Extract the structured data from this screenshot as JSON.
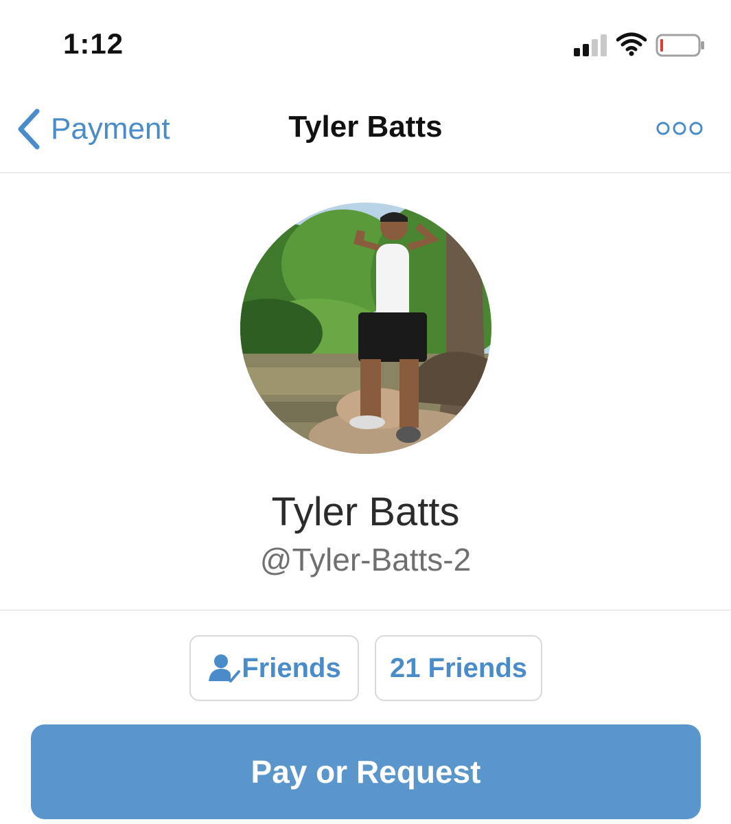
{
  "status_bar": {
    "time": "1:12"
  },
  "nav": {
    "back_label": "Payment",
    "title": "Tyler Batts",
    "accent_color": "#4a8bc9"
  },
  "profile": {
    "name": "Tyler Batts",
    "handle": "@Tyler-Batts-2",
    "avatar_icon": "profile-photo"
  },
  "friends": {
    "status_label": "Friends",
    "status_icon": "friend-check-icon",
    "count_label": "21 Friends"
  },
  "action": {
    "pay_label": "Pay or Request",
    "button_color": "#5a95cb"
  }
}
